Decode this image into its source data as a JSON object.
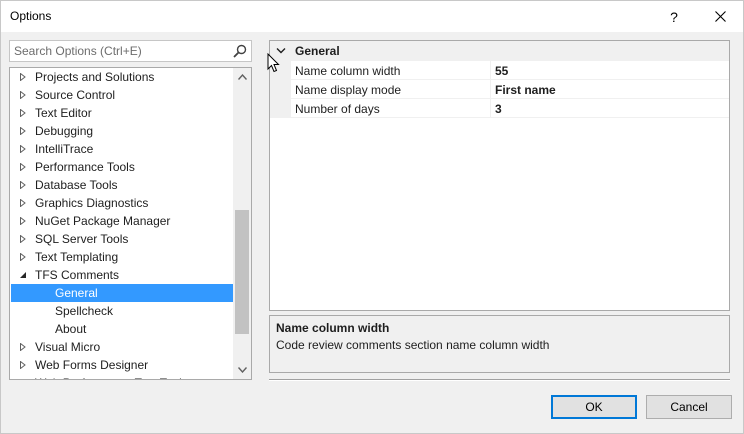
{
  "window": {
    "title": "Options",
    "help_glyph": "?",
    "close_glyph": "✕"
  },
  "search": {
    "placeholder": "Search Options (Ctrl+E)",
    "icon": "search-icon"
  },
  "tree": {
    "selected_index": 11,
    "items": [
      {
        "label": "Projects and Solutions",
        "expanded": false
      },
      {
        "label": "Source Control",
        "expanded": false
      },
      {
        "label": "Text Editor",
        "expanded": false
      },
      {
        "label": "Debugging",
        "expanded": false
      },
      {
        "label": "IntelliTrace",
        "expanded": false
      },
      {
        "label": "Performance Tools",
        "expanded": false
      },
      {
        "label": "Database Tools",
        "expanded": false
      },
      {
        "label": "Graphics Diagnostics",
        "expanded": false
      },
      {
        "label": "NuGet Package Manager",
        "expanded": false
      },
      {
        "label": "SQL Server Tools",
        "expanded": false
      },
      {
        "label": "Text Templating",
        "expanded": false
      },
      {
        "label": "TFS Comments",
        "expanded": true
      },
      {
        "label": "General",
        "child": true,
        "selected": true
      },
      {
        "label": "Spellcheck",
        "child": true
      },
      {
        "label": "About",
        "child": true
      },
      {
        "label": "Visual Micro",
        "expanded": false
      },
      {
        "label": "Web Forms Designer",
        "expanded": false
      },
      {
        "label": "Web Performance Test Tools",
        "expanded": false
      }
    ]
  },
  "properties": {
    "category": "General",
    "rows": [
      {
        "name": "Name column width",
        "value": "55"
      },
      {
        "name": "Name display mode",
        "value": "First name"
      },
      {
        "name": "Number of days",
        "value": "3"
      }
    ]
  },
  "description": {
    "title": "Name column width",
    "text": "Code review comments section name column width"
  },
  "buttons": {
    "ok": "OK",
    "cancel": "Cancel"
  },
  "colors": {
    "selection": "#3399ff",
    "accent": "#0078d7"
  }
}
